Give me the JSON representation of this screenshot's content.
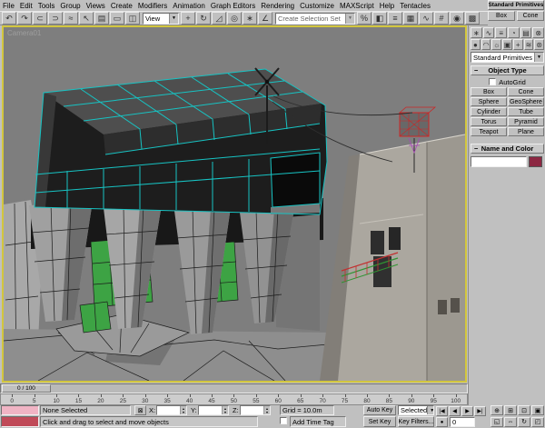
{
  "menubar": {
    "items": [
      "File",
      "Edit",
      "Tools",
      "Group",
      "Views",
      "Create",
      "Modifiers",
      "Animation",
      "Graph Editors",
      "Rendering",
      "Customize",
      "MAXScript",
      "Help",
      "Tentacles"
    ]
  },
  "floating_palette": {
    "title": "Standard Primitives",
    "buttons": [
      {
        "name": "palette-box-button",
        "label": "Box"
      },
      {
        "name": "palette-cone-button",
        "label": "Cone"
      }
    ]
  },
  "toolbar": {
    "group_a": [
      {
        "name": "undo-icon",
        "label": "↶"
      },
      {
        "name": "redo-icon",
        "label": "↷"
      },
      {
        "name": "select-and-link-icon",
        "label": "⊂"
      },
      {
        "name": "unlink-selection-icon",
        "label": "⊃"
      },
      {
        "name": "bind-to-space-warp-icon",
        "label": "≈"
      },
      {
        "name": "select-object-icon",
        "label": "↖"
      },
      {
        "name": "select-by-name-icon",
        "label": "▤"
      },
      {
        "name": "rectangular-selection-region-icon",
        "label": "▭"
      },
      {
        "name": "window-crossing-icon",
        "label": "◫"
      }
    ],
    "coord_system_value": "View",
    "group_b": [
      {
        "name": "select-and-move-icon",
        "label": "+"
      },
      {
        "name": "select-and-rotate-icon",
        "label": "↻"
      },
      {
        "name": "select-and-scale-icon",
        "label": "◿"
      },
      {
        "name": "use-pivot-center-icon",
        "label": "◎"
      },
      {
        "name": "select-and-manipulate-icon",
        "label": "∗"
      },
      {
        "name": "snaps-toggle-icon",
        "label": "∠"
      }
    ],
    "selection_set_value": "Create Selection Set",
    "group_c": [
      {
        "name": "percent-snap-icon",
        "label": "%"
      },
      {
        "name": "mirror-icon",
        "label": "◧"
      },
      {
        "name": "align-icon",
        "label": "≡"
      },
      {
        "name": "layers-icon",
        "label": "▦"
      },
      {
        "name": "curve-editor-icon",
        "label": "∿"
      },
      {
        "name": "schematic-view-icon",
        "label": "#"
      },
      {
        "name": "material-editor-icon",
        "label": "◉"
      },
      {
        "name": "render-scene-icon",
        "label": "▩"
      }
    ]
  },
  "command_panel": {
    "tabs": [
      {
        "name": "create-tab",
        "label": "∗"
      },
      {
        "name": "modify-tab",
        "label": "∿"
      },
      {
        "name": "hierarchy-tab",
        "label": "≡"
      },
      {
        "name": "motion-tab",
        "label": "◔"
      },
      {
        "name": "display-tab",
        "label": "▤"
      },
      {
        "name": "utilities-tab",
        "label": "⊗"
      }
    ],
    "categories": [
      {
        "name": "geometry-category",
        "label": "●"
      },
      {
        "name": "shapes-category",
        "label": "◠"
      },
      {
        "name": "lights-category",
        "label": "☼"
      },
      {
        "name": "cameras-category",
        "label": "▣"
      },
      {
        "name": "helpers-category",
        "label": "+"
      },
      {
        "name": "space-warps-category",
        "label": "≋"
      },
      {
        "name": "systems-category",
        "label": "⊛"
      }
    ],
    "dropdown_value": "Standard Primitives",
    "collapse_glyph": "−",
    "object_type_rollout": "Object Type",
    "autogrid_label": "AutoGrid",
    "object_type_buttons": [
      {
        "name": "box-button",
        "label": "Box"
      },
      {
        "name": "cone-button",
        "label": "Cone"
      },
      {
        "name": "sphere-button",
        "label": "Sphere"
      },
      {
        "name": "geosphere-button",
        "label": "GeoSphere"
      },
      {
        "name": "cylinder-button",
        "label": "Cylinder"
      },
      {
        "name": "tube-button",
        "label": "Tube"
      },
      {
        "name": "torus-button",
        "label": "Torus"
      },
      {
        "name": "pyramid-button",
        "label": "Pyramid"
      },
      {
        "name": "teapot-button",
        "label": "Teapot"
      },
      {
        "name": "plane-button",
        "label": "Plane"
      }
    ],
    "name_color_rollout": "Name and Color",
    "object_name_value": ""
  },
  "viewport": {
    "label": "Camera01"
  },
  "timeline": {
    "slider_label": "0 / 100",
    "ticks": [
      "0",
      "5",
      "10",
      "15",
      "20",
      "25",
      "30",
      "35",
      "40",
      "45",
      "50",
      "55",
      "60",
      "65",
      "70",
      "75",
      "80",
      "85",
      "90",
      "95",
      "100"
    ]
  },
  "statusbar": {
    "selection_status": "None Selected",
    "prompt": "Click and drag to select and move objects",
    "x_label": "X:",
    "y_label": "Y:",
    "z_label": "Z:",
    "x_value": "",
    "y_value": "",
    "z_value": "",
    "grid_label": "Grid = 10.0m",
    "add_time_tag": "Add Time Tag",
    "auto_key_label": "Auto Key",
    "set_key_label": "Set Key",
    "selected_combo_value": "Selected",
    "key_filters_label": "Key Filters...",
    "frame_value": "0"
  },
  "transport": {
    "buttons": [
      {
        "name": "go-to-start-button",
        "label": "|◀"
      },
      {
        "name": "previous-frame-button",
        "label": "◀"
      },
      {
        "name": "play-button",
        "label": "▶"
      },
      {
        "name": "go-to-end-button",
        "label": "▶|"
      }
    ],
    "key_toggle_glyph": "●"
  },
  "nav": {
    "buttons": [
      {
        "name": "zoom-button",
        "label": "⊕"
      },
      {
        "name": "zoom-all-button",
        "label": "⊞"
      },
      {
        "name": "zoom-extents-button",
        "label": "⊡"
      },
      {
        "name": "zoom-extents-all-button",
        "label": "▣"
      },
      {
        "name": "zoom-region-button",
        "label": "◱"
      },
      {
        "name": "pan-button",
        "label": "⇔"
      },
      {
        "name": "arc-rotate-button",
        "label": "↻"
      },
      {
        "name": "min-max-toggle-button",
        "label": "◰"
      }
    ]
  },
  "icons": {
    "dropdown_arrow": "▼",
    "spinner_up": "▴",
    "spinner_down": "▾",
    "lock": "⊠"
  },
  "colors": {
    "accent-yellow": "#d2c63e",
    "wire-cyan": "#17c3c3",
    "sel-green": "#3da344",
    "viewport-bg": "#7e7e7e",
    "swatch-maroon": "#8c2742",
    "listener-pink": "#f0b4c4",
    "listener-red": "#c04a58"
  }
}
